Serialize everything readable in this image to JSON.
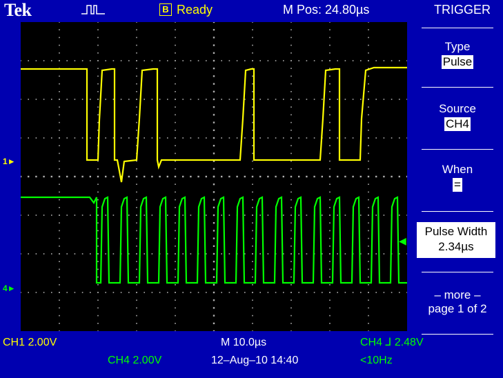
{
  "header": {
    "brand": "Tek",
    "acq_mode": "B",
    "acq_status": "Ready",
    "mpos": "M Pos: 24.80µs",
    "menu_title": "TRIGGER"
  },
  "menu": {
    "type_label": "Type",
    "type_value": "Pulse",
    "source_label": "Source",
    "source_value": "CH4",
    "when_label": "When",
    "when_value": "=",
    "pulse_width_label": "Pulse Width",
    "pulse_width_value": "2.34µs",
    "more_label": "– more –",
    "page_label": "page 1 of 2"
  },
  "markers": {
    "ch1": "1",
    "ch4": "4"
  },
  "status": {
    "ch1_scale": "CH1  2.00V",
    "ch4_scale": "CH4  2.00V",
    "timebase": "M 10.0µs",
    "datetime": "12–Aug–10 14:40",
    "trigger": "CH4 ⅃ 2.48V",
    "freq": "<10Hz"
  },
  "colors": {
    "background": "#0000b0",
    "screen": "#000000",
    "ch1": "#ffff00",
    "ch4": "#00ff00",
    "grid": "#b0b0b0"
  }
}
